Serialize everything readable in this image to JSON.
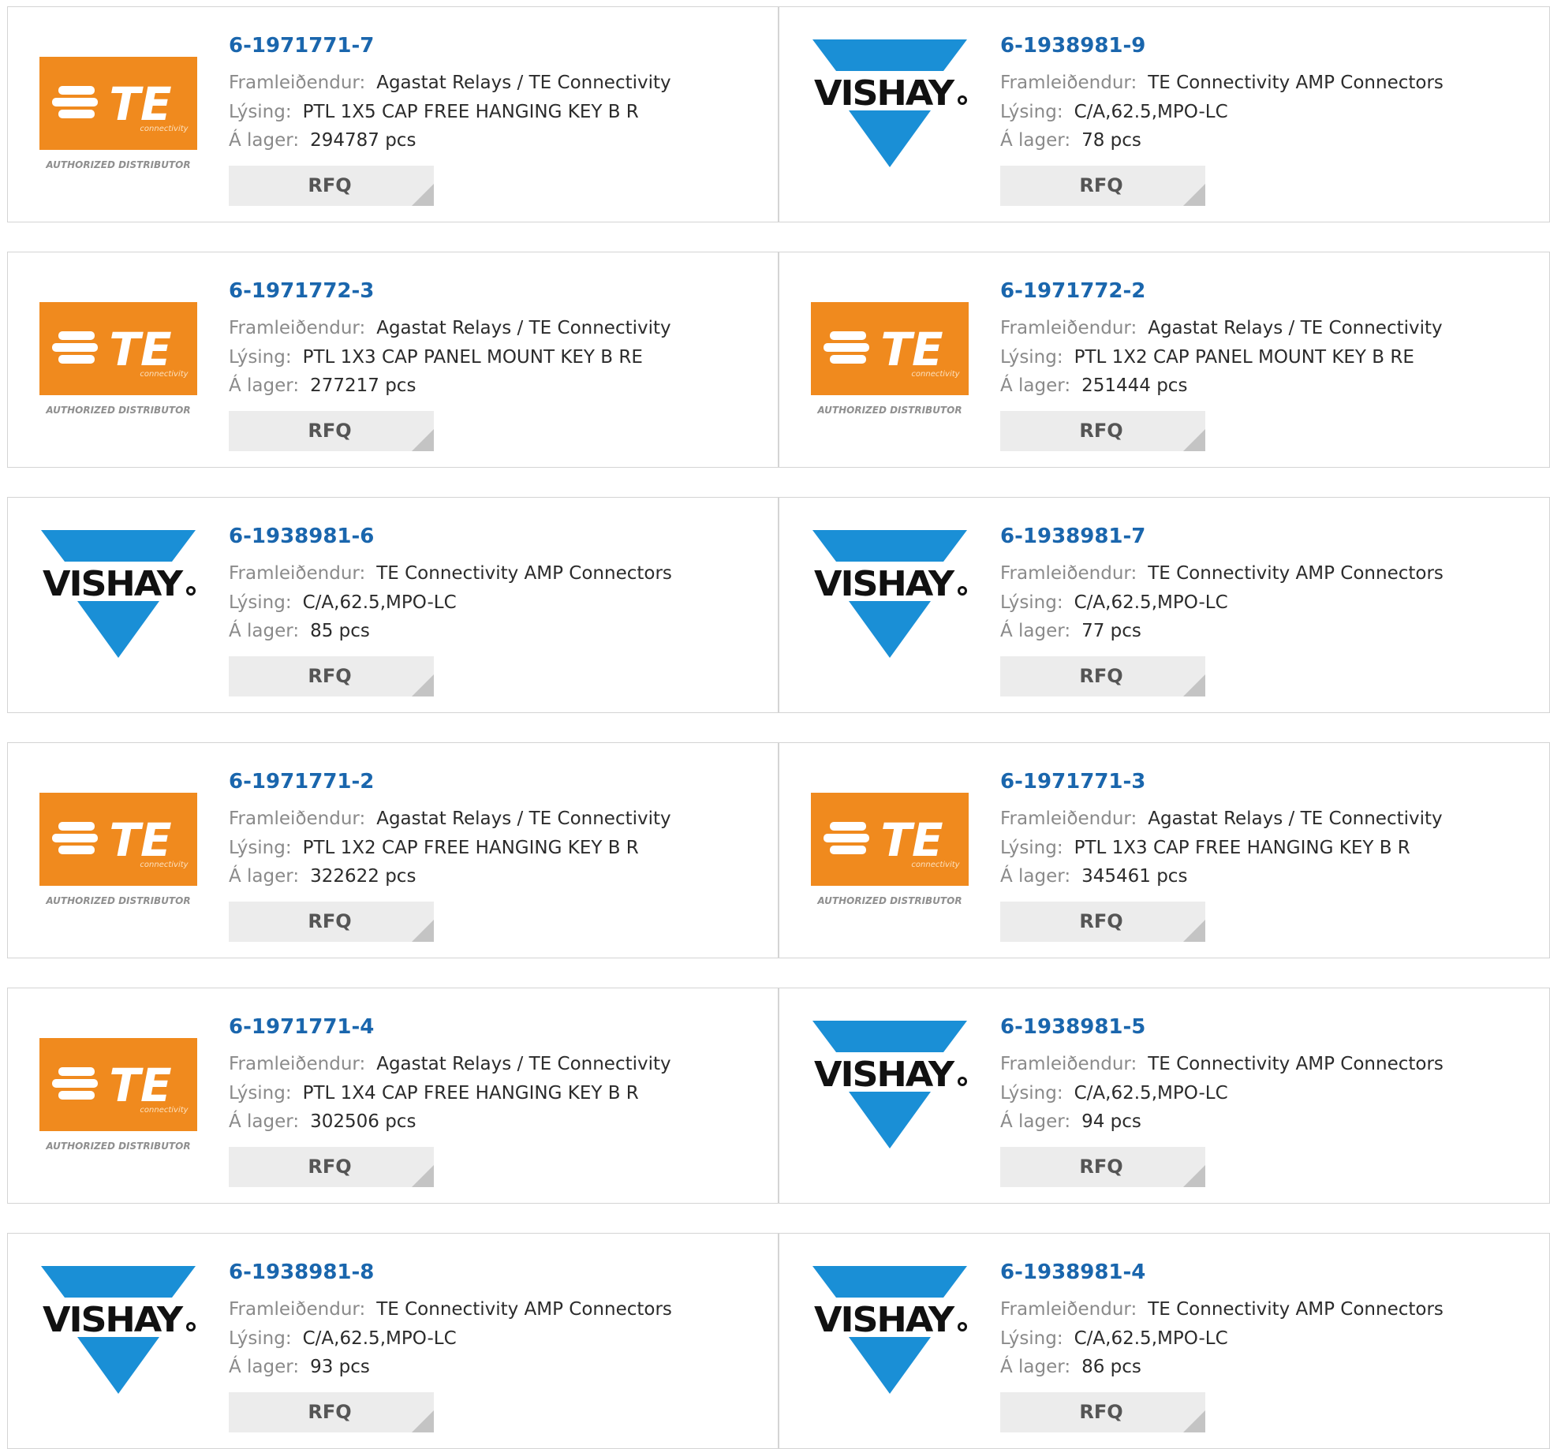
{
  "labels": {
    "manufacturer": "Framleiðendur:",
    "description": "Lýsing:",
    "stock": "Á lager:",
    "rfq": "RFQ"
  },
  "logos": {
    "te": {
      "wordmark": "TE",
      "tagline": "connectivity",
      "caption": "AUTHORIZED DISTRIBUTOR",
      "color": "#f08a1e"
    },
    "vishay": {
      "wordmark": "VISHAY",
      "color": "#1a8fd6"
    }
  },
  "products": [
    {
      "part": "6-1971771-7",
      "logo": "te",
      "manufacturer": "Agastat Relays / TE Connectivity",
      "description": "PTL 1X5 CAP FREE HANGING KEY B R",
      "stock": "294787 pcs"
    },
    {
      "part": "6-1938981-9",
      "logo": "vishay",
      "manufacturer": "TE Connectivity AMP Connectors",
      "description": "C/A,62.5,MPO-LC",
      "stock": "78 pcs"
    },
    {
      "part": "6-1971772-3",
      "logo": "te",
      "manufacturer": "Agastat Relays / TE Connectivity",
      "description": "PTL 1X3 CAP PANEL MOUNT KEY B RE",
      "stock": "277217 pcs"
    },
    {
      "part": "6-1971772-2",
      "logo": "te",
      "manufacturer": "Agastat Relays / TE Connectivity",
      "description": "PTL 1X2 CAP PANEL MOUNT KEY B RE",
      "stock": "251444 pcs"
    },
    {
      "part": "6-1938981-6",
      "logo": "vishay",
      "manufacturer": "TE Connectivity AMP Connectors",
      "description": "C/A,62.5,MPO-LC",
      "stock": "85 pcs"
    },
    {
      "part": "6-1938981-7",
      "logo": "vishay",
      "manufacturer": "TE Connectivity AMP Connectors",
      "description": "C/A,62.5,MPO-LC",
      "stock": "77 pcs"
    },
    {
      "part": "6-1971771-2",
      "logo": "te",
      "manufacturer": "Agastat Relays / TE Connectivity",
      "description": "PTL 1X2 CAP FREE HANGING KEY B R",
      "stock": "322622 pcs"
    },
    {
      "part": "6-1971771-3",
      "logo": "te",
      "manufacturer": "Agastat Relays / TE Connectivity",
      "description": "PTL 1X3 CAP FREE HANGING KEY B R",
      "stock": "345461 pcs"
    },
    {
      "part": "6-1971771-4",
      "logo": "te",
      "manufacturer": "Agastat Relays / TE Connectivity",
      "description": "PTL 1X4 CAP FREE HANGING KEY B R",
      "stock": "302506 pcs"
    },
    {
      "part": "6-1938981-5",
      "logo": "vishay",
      "manufacturer": "TE Connectivity AMP Connectors",
      "description": "C/A,62.5,MPO-LC",
      "stock": "94 pcs"
    },
    {
      "part": "6-1938981-8",
      "logo": "vishay",
      "manufacturer": "TE Connectivity AMP Connectors",
      "description": "C/A,62.5,MPO-LC",
      "stock": "93 pcs"
    },
    {
      "part": "6-1938981-4",
      "logo": "vishay",
      "manufacturer": "TE Connectivity AMP Connectors",
      "description": "C/A,62.5,MPO-LC",
      "stock": "86 pcs"
    }
  ]
}
